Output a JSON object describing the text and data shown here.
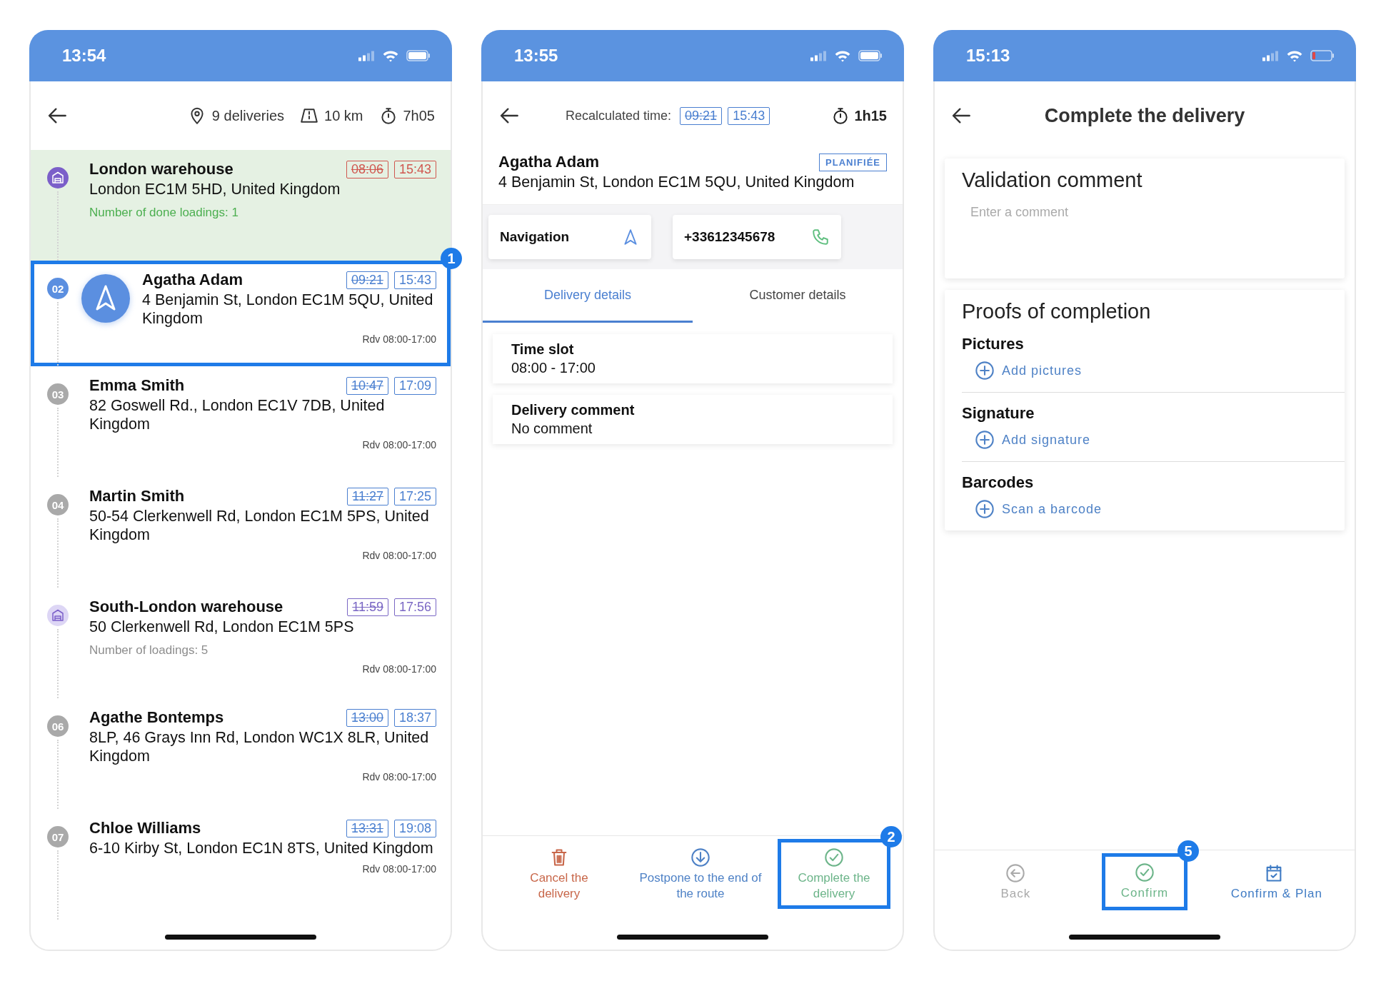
{
  "screens": [
    {
      "kind": "route",
      "status_bar": {
        "time": "13:54",
        "battery_low": false
      },
      "summary": [
        {
          "kind": "pin",
          "text": "9 deliveries"
        },
        {
          "kind": "road",
          "text": "10 km"
        },
        {
          "kind": "timer",
          "text": "7h05"
        }
      ],
      "stops": [
        {
          "kind": "warehouse",
          "name": "London warehouse",
          "address": "London EC1M 5HD, United Kingdom",
          "planned": "08:06",
          "eta": "15:43",
          "color": "#d0574f",
          "note": "Number of done loadings: 1",
          "done": true,
          "current": false
        },
        {
          "kind": "delivery",
          "number": "02",
          "name": "Agatha Adam",
          "address": "4 Benjamin St, London EC1M 5QU, United Kingdom",
          "planned": "09:21",
          "eta": "15:43",
          "color": "#4a7fd0",
          "rdv": "Rdv 08:00-17:00",
          "done": false,
          "current": true,
          "callout": "1"
        },
        {
          "kind": "delivery",
          "number": "03",
          "name": "Emma Smith",
          "address": "82 Goswell Rd., London EC1V 7DB, United Kingdom",
          "planned": "10:47",
          "eta": "17:09",
          "color": "#4a7fd0",
          "rdv": "Rdv 08:00-17:00",
          "done": false,
          "current": false
        },
        {
          "kind": "delivery",
          "number": "04",
          "name": "Martin Smith",
          "address": "50-54 Clerkenwell Rd, London EC1M 5PS, United Kingdom",
          "planned": "11:27",
          "eta": "17:25",
          "color": "#4a7fd0",
          "rdv": "Rdv 08:00-17:00",
          "done": false,
          "current": false
        },
        {
          "kind": "warehouse",
          "name": "South-London warehouse",
          "address": "50 Clerkenwell Rd, London EC1M 5PS",
          "planned": "11:59",
          "eta": "17:56",
          "color": "#7a67c4",
          "note": "Number of loadings: 5",
          "rdv": "Rdv 08:00-17:00",
          "done": false,
          "current": false
        },
        {
          "kind": "delivery",
          "number": "06",
          "name": "Agathe Bontemps",
          "address": "8LP, 46 Grays Inn Rd, London WC1X 8LR, United Kingdom",
          "planned": "13:00",
          "eta": "18:37",
          "color": "#4a7fd0",
          "rdv": "Rdv 08:00-17:00",
          "done": false,
          "current": false
        },
        {
          "kind": "delivery",
          "number": "07",
          "name": "Chloe Williams",
          "address": "6-10 Kirby St, London EC1N 8TS, United Kingdom",
          "planned": "13:31",
          "eta": "19:08",
          "color": "#4a7fd0",
          "rdv": "Rdv 08:00-17:00",
          "done": false,
          "current": false
        }
      ]
    },
    {
      "kind": "detail",
      "status_bar": {
        "time": "13:55",
        "battery_low": false
      },
      "recalc_label": "Recalculated time:",
      "planned": "09:21",
      "eta": "15:43",
      "duration": "1h15",
      "customer": {
        "name": "Agatha Adam",
        "address": "4 Benjamin St, London EC1M 5QU, United Kingdom",
        "status": "PLANIFIÉE"
      },
      "quick_actions": [
        {
          "kind": "navigation",
          "label": "Navigation"
        },
        {
          "kind": "phone",
          "label": "+33612345678"
        }
      ],
      "tabs": [
        {
          "label": "Delivery details",
          "selected": true
        },
        {
          "label": "Customer details",
          "selected": false
        }
      ],
      "details": [
        {
          "title": "Time slot",
          "value": "08:00 - 17:00"
        },
        {
          "title": "Delivery comment",
          "value": "No comment"
        }
      ],
      "actions": [
        {
          "kind": "cancel",
          "label": "Cancel the delivery"
        },
        {
          "kind": "postpone",
          "label": "Postpone to the end of the route"
        },
        {
          "kind": "complete",
          "label": "Complete the delivery",
          "callout": "2"
        }
      ]
    },
    {
      "kind": "complete",
      "status_bar": {
        "time": "15:13",
        "battery_low": true
      },
      "title": "Complete the delivery",
      "comment": {
        "title": "Validation comment",
        "placeholder": "Enter a comment"
      },
      "proofs": {
        "title": "Proofs of completion",
        "sections": [
          {
            "title": "Pictures",
            "action": "Add pictures"
          },
          {
            "title": "Signature",
            "action": "Add signature"
          },
          {
            "title": "Barcodes",
            "action": "Scan a barcode"
          }
        ]
      },
      "actions": [
        {
          "kind": "back",
          "label": "Back",
          "disabled": true
        },
        {
          "kind": "confirm",
          "label": "Confirm",
          "disabled": false,
          "callout": "5"
        },
        {
          "kind": "confirm_plan",
          "label": "Confirm & Plan",
          "disabled": false
        }
      ]
    }
  ]
}
